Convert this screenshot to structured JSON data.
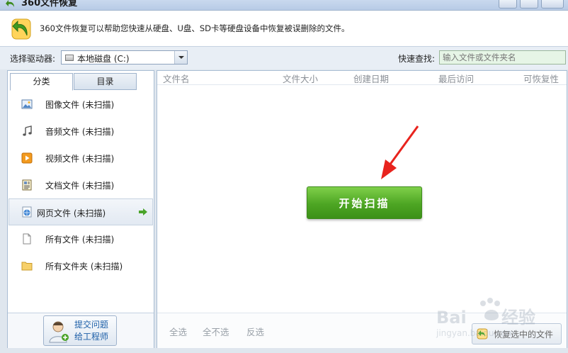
{
  "window": {
    "title": "360文件恢复",
    "icon": "back-arrow-icon"
  },
  "banner": {
    "text": "360文件恢复可以帮助您快速从硬盘、U盘、SD卡等硬盘设备中恢复被误删除的文件。",
    "icon": "recover-arrow-logo"
  },
  "toolbar": {
    "drive_label": "选择驱动器:",
    "drive_value": "本地磁盘 (C:)",
    "search_label": "快速查找:",
    "search_placeholder": "输入文件或文件夹名"
  },
  "tabs": [
    {
      "label": "分类",
      "active": true
    },
    {
      "label": "目录",
      "active": false
    }
  ],
  "categories": [
    {
      "label": "图像文件 (未扫描)",
      "icon": "image-file-icon",
      "selected": false
    },
    {
      "label": "音频文件 (未扫描)",
      "icon": "music-note-icon",
      "selected": false
    },
    {
      "label": "视频文件 (未扫描)",
      "icon": "video-file-icon",
      "selected": false
    },
    {
      "label": "文档文件 (未扫描)",
      "icon": "document-file-icon",
      "selected": false
    },
    {
      "label": "网页文件 (未扫描)",
      "icon": "web-file-icon",
      "selected": true
    },
    {
      "label": "所有文件 (未扫描)",
      "icon": "blank-file-icon",
      "selected": false
    },
    {
      "label": "所有文件夹 (未扫描)",
      "icon": "folder-icon",
      "selected": false
    }
  ],
  "engineer_button": {
    "line1": "提交问题",
    "line2": "给工程师"
  },
  "columns": [
    "文件名",
    "文件大小",
    "创建日期",
    "最后访问",
    "可恢复性"
  ],
  "scan_button": "开始扫描",
  "selection": {
    "select_all": "全选",
    "select_none": "全不选",
    "invert": "反选"
  },
  "restore_button": "恢复选中的文件",
  "colors": {
    "scan_green": "#4da523",
    "link_blue": "#1d5fa8",
    "arrow_red": "#e8231d"
  }
}
